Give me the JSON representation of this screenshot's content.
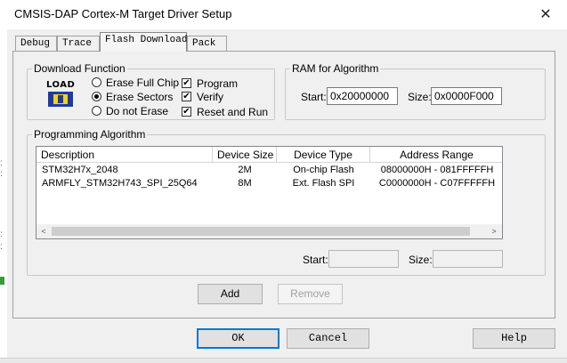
{
  "window": {
    "title": "CMSIS-DAP Cortex-M Target Driver Setup",
    "close_glyph": "✕"
  },
  "tabs": [
    {
      "label": "Debug",
      "active": false
    },
    {
      "label": "Trace",
      "active": false
    },
    {
      "label": "Flash Download",
      "active": true
    },
    {
      "label": "Pack",
      "active": false
    }
  ],
  "download_function": {
    "label": "Download Function",
    "logo_text": "LOAD",
    "radios": [
      {
        "label": "Erase Full Chip",
        "checked": false
      },
      {
        "label": "Erase Sectors",
        "checked": true
      },
      {
        "label": "Do not Erase",
        "checked": false
      }
    ],
    "checks": [
      {
        "label": "Program",
        "checked": true
      },
      {
        "label": "Verify",
        "checked": true
      },
      {
        "label": "Reset and Run",
        "checked": true
      }
    ]
  },
  "ram": {
    "label": "RAM for Algorithm",
    "start_label": "Start:",
    "start_value": "0x20000000",
    "size_label": "Size:",
    "size_value": "0x0000F000"
  },
  "algorithm": {
    "label": "Programming Algorithm",
    "columns": [
      "Description",
      "Device Size",
      "Device Type",
      "Address Range"
    ],
    "rows": [
      [
        "STM32H7x_2048",
        "2M",
        "On-chip Flash",
        "08000000H - 081FFFFFH"
      ],
      [
        "ARMFLY_STM32H743_SPI_25Q64",
        "8M",
        "Ext. Flash SPI",
        "C0000000H - C07FFFFFH"
      ]
    ],
    "start_label": "Start:",
    "start_value": "",
    "size_label": "Size:",
    "size_value": "",
    "add_label": "Add",
    "remove_label": "Remove"
  },
  "footer": {
    "ok": "OK",
    "cancel": "Cancel",
    "help": "Help"
  }
}
